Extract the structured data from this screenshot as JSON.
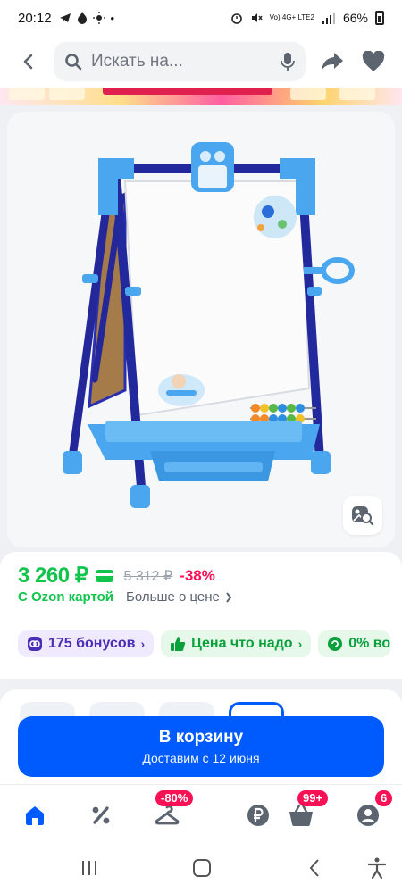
{
  "status_bar": {
    "time": "20:12",
    "network": "Vo) 4G+ LTE2",
    "battery": "66%"
  },
  "top_nav": {
    "search_placeholder": "Искать на..."
  },
  "price": {
    "current": "3 260 ₽",
    "old": "5 312 ₽",
    "discount": "-38%",
    "ozon_card_label": "С Ozon картой",
    "more_about_price": "Больше о цене"
  },
  "chips": [
    {
      "label": "175 бонусов"
    },
    {
      "label": "Цена что надо"
    },
    {
      "label": "0% во"
    }
  ],
  "cart": {
    "label": "В корзину",
    "delivery": "Доставим с 12 июня"
  },
  "tabbar": {
    "badges": {
      "sale": "-80%",
      "cart": "99+",
      "profile": "6"
    }
  },
  "colors": {
    "accent": "#005bff",
    "price_green": "#10c44c",
    "discount_red": "#f91155"
  },
  "icons": [
    "back-arrow-icon",
    "search-icon",
    "mic-icon",
    "share-icon",
    "heart-icon",
    "similar-search-icon",
    "home-icon",
    "percent-icon",
    "hanger-icon",
    "ruble-icon",
    "cart-icon",
    "profile-icon"
  ]
}
